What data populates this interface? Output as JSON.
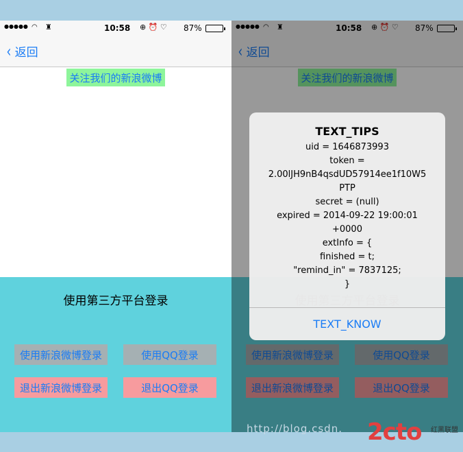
{
  "status_bar": {
    "signal": "●●●●●",
    "wifi_glyph": "◠",
    "app_glyph": "♜",
    "time": "10:58",
    "icons": "⊕ ⏰ ♡",
    "battery_percent": "87%",
    "battery_level": 0.87
  },
  "nav": {
    "back_label": "返回",
    "back_glyph": "‹"
  },
  "follow_weibo_label": "关注我们的新浪微博",
  "login": {
    "title": "使用第三方平台登录",
    "weibo_login_label": "使用新浪微博登录",
    "qq_login_label": "使用QQ登录",
    "weibo_logout_label": "退出新浪微博登录",
    "qq_logout_label": "退出QQ登录"
  },
  "alert": {
    "title": "TEXT_TIPS",
    "lines": [
      "uid = 1646873993",
      "token =",
      "2.00lJH9nB4qsdUD57914ee1f10W5",
      "PTP",
      "secret = (null)",
      "expired = 2014-09-22 19:00:01",
      "+0000",
      "extInfo = {",
      "finished = t;",
      "\"remind_in\" = 7837125;",
      "}"
    ],
    "button_label": "TEXT_KNOW"
  },
  "watermark": "http://blog.csdn.",
  "brand": {
    "logo": "2cto",
    "sub": "红黑联盟"
  },
  "colors": {
    "accent": "#1a7cf5",
    "panel": "#5fd2dd",
    "follow_bg": "#8ef59b",
    "button_gray": "#a5b0b3",
    "button_red": "#f79b9e"
  }
}
